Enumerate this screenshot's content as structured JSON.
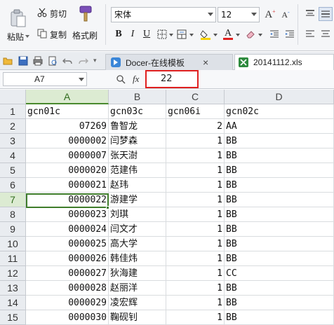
{
  "ribbon": {
    "paste_label": "粘贴",
    "cut_label": "剪切",
    "copy_label": "复制",
    "format_painter_label": "格式刷",
    "font_name": "宋体",
    "font_size": "12",
    "bold": "B",
    "italic": "I",
    "underline": "U",
    "font_color_letter": "A",
    "font_color": "#e02020",
    "fill_color": "#f5d200"
  },
  "tabs": [
    {
      "label": "Docer-在线模板",
      "close": "×"
    },
    {
      "label": "20141112.xls"
    }
  ],
  "formula_bar": {
    "name_box": "A7",
    "fx": "fx",
    "value": "22",
    "highlight_color": "#e02020"
  },
  "sheet": {
    "columns": [
      "A",
      "B",
      "C",
      "D"
    ],
    "selected_column": "A",
    "selected_row": "7",
    "rows": [
      {
        "n": "1",
        "a": "gcn01c",
        "b": "gcn03c",
        "c": "gcn06i",
        "d": "gcn02c"
      },
      {
        "n": "2",
        "a": "07269",
        "b": "鲁智龙",
        "c": "2",
        "d": "AA"
      },
      {
        "n": "3",
        "a": "0000002",
        "b": "闫梦森",
        "c": "1",
        "d": "BB"
      },
      {
        "n": "4",
        "a": "0000007",
        "b": "张天澍",
        "c": "1",
        "d": "BB"
      },
      {
        "n": "5",
        "a": "0000020",
        "b": "范建伟",
        "c": "1",
        "d": "BB"
      },
      {
        "n": "6",
        "a": "0000021",
        "b": "赵玮",
        "c": "1",
        "d": "BB"
      },
      {
        "n": "7",
        "a": "0000022",
        "b": "游建学",
        "c": "1",
        "d": "BB"
      },
      {
        "n": "8",
        "a": "0000023",
        "b": "刘琪",
        "c": "1",
        "d": "BB"
      },
      {
        "n": "9",
        "a": "0000024",
        "b": "闫文才",
        "c": "1",
        "d": "BB"
      },
      {
        "n": "10",
        "a": "0000025",
        "b": "高大学",
        "c": "1",
        "d": "BB"
      },
      {
        "n": "11",
        "a": "0000026",
        "b": "韩佳炜",
        "c": "1",
        "d": "BB"
      },
      {
        "n": "12",
        "a": "0000027",
        "b": "狄海建",
        "c": "1",
        "d": "CC"
      },
      {
        "n": "13",
        "a": "0000028",
        "b": "赵丽洋",
        "c": "1",
        "d": "BB"
      },
      {
        "n": "14",
        "a": "0000029",
        "b": "凌宏辉",
        "c": "1",
        "d": "BB"
      },
      {
        "n": "15",
        "a": "0000030",
        "b": "鞠砚钊",
        "c": "1",
        "d": "BB"
      }
    ]
  }
}
